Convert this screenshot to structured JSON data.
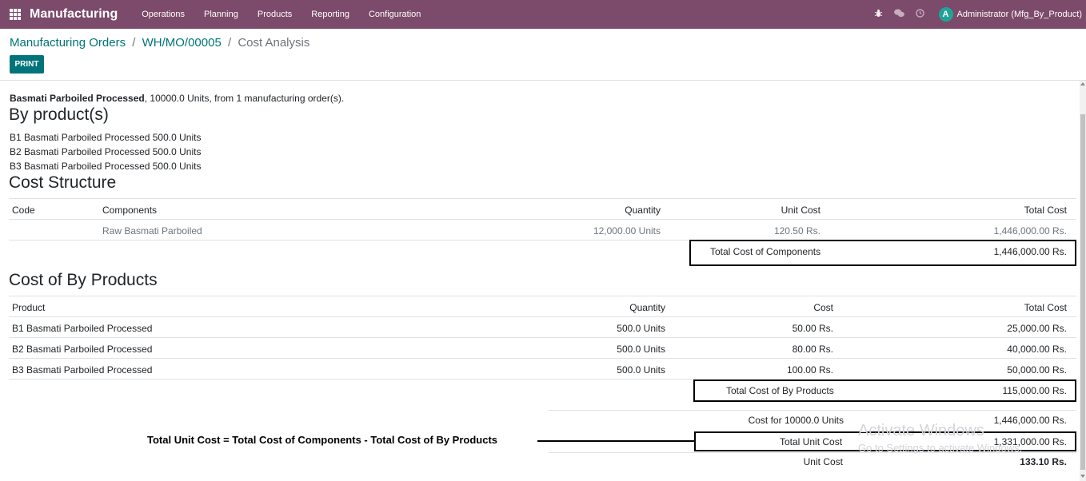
{
  "navbar": {
    "app_name": "Manufacturing",
    "menu": [
      "Operations",
      "Planning",
      "Products",
      "Reporting",
      "Configuration"
    ],
    "icons": [
      "bug-icon",
      "chat-icon",
      "clock-icon"
    ],
    "avatar_letter": "A",
    "user": "Administrator (Mfg_By_Product)",
    "bg_color": "#7c4a6a"
  },
  "breadcrumb": {
    "items": [
      "Manufacturing Orders",
      "WH/MO/00005"
    ],
    "separator": "/",
    "current": "Cost Analysis"
  },
  "print_label": "PRINT",
  "report": {
    "summary_product": "Basmati Parboiled Processed",
    "summary_rest": ", 10000.0 Units, from 1 manufacturing order(s).",
    "byproducts_title": "By product(s)",
    "byproducts": [
      "B1 Basmati Parboiled Processed 500.0 Units",
      "B2 Basmati Parboiled Processed 500.0 Units",
      "B3 Basmati Parboiled Processed 500.0 Units"
    ],
    "cost_structure": {
      "title": "Cost Structure",
      "headers": [
        "Code",
        "Components",
        "Quantity",
        "Unit Cost",
        "Total Cost"
      ],
      "rows": [
        {
          "code": "",
          "component": "Raw Basmati Parboiled",
          "quantity": "12,000.00 Units",
          "unit_cost": "120.50 Rs.",
          "total": "1,446,000.00 Rs."
        }
      ],
      "total_label": "Total Cost of Components",
      "total_value": "1,446,000.00 Rs."
    },
    "byproduct_costs": {
      "title": "Cost of By Products",
      "headers": [
        "Product",
        "Quantity",
        "Cost",
        "Total Cost"
      ],
      "rows": [
        {
          "product": "B1 Basmati Parboiled Processed",
          "quantity": "500.0 Units",
          "cost": "50.00 Rs.",
          "total": "25,000.00 Rs."
        },
        {
          "product": "B2 Basmati Parboiled Processed",
          "quantity": "500.0 Units",
          "cost": "80.00 Rs.",
          "total": "40,000.00 Rs."
        },
        {
          "product": "B3 Basmati Parboiled Processed",
          "quantity": "500.0 Units",
          "cost": "100.00 Rs.",
          "total": "50,000.00 Rs."
        }
      ],
      "total_label": "Total Cost of By Products",
      "total_value": "115,000.00 Rs."
    },
    "summary_table": {
      "cost_for_label": "Cost for 10000.0 Units",
      "cost_for_value": "1,446,000.00 Rs.",
      "total_unit_cost_label": "Total Unit Cost",
      "total_unit_cost_value": "1,331,000.00 Rs.",
      "unit_cost_label": "Unit Cost",
      "unit_cost_value": "133.10 Rs."
    }
  },
  "annotation": "Total Unit Cost = Total Cost of Components - Total Cost of By Products",
  "watermark": {
    "line1": "Activate Windows",
    "line2": "Go to Settings to activate Windows."
  }
}
